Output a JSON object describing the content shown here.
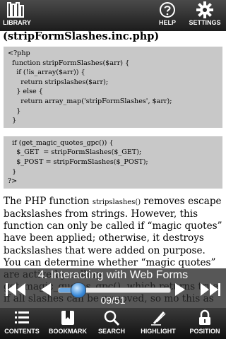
{
  "topbar": {
    "library_label": "LIBRARY",
    "help_label": "HELP",
    "settings_label": "SETTINGS"
  },
  "content": {
    "section_title": "(stripFormSlashes.inc.php)",
    "code_block_1": [
      "<?php",
      "  function stripFormSlashes($arr) {",
      "    if (!is_array($arr)) {",
      "      return stripslashes($arr);",
      "    } else {",
      "      return array_map('stripFormSlashes', $arr);",
      "    }",
      "  }"
    ],
    "code_block_2": [
      "  if (get_magic_quotes_gpc()) {",
      "    $_GET  = stripFormSlashes($_GET);",
      "    $_POST = stripFormSlashes($_POST);",
      "  }",
      "?>"
    ],
    "paragraph": {
      "part1": "The PHP function ",
      "inline_code": "stripslashes()",
      "part2": " removes escape backslashes from strings. However, this function can only be called if “magic quotes” have been applied; otherwise, it destroys backslashes that were added on purpose. You can determine whether “magic quotes” are active by calling get_magic_quotes_gpc(), which returns true if all slashes can be removed, so mo this as"
    }
  },
  "overlay": {
    "chapter_title": "4. Interacting with Web Forms",
    "page_count": "09/51",
    "progress": 0.18,
    "accent_color": "#3a8ad8"
  },
  "tabbar": {
    "contents_label": "CONTENTS",
    "bookmark_label": "BOOKMARK",
    "search_label": "SEARCH",
    "highlight_label": "HIGHLIGHT",
    "position_label": "POSITION"
  }
}
